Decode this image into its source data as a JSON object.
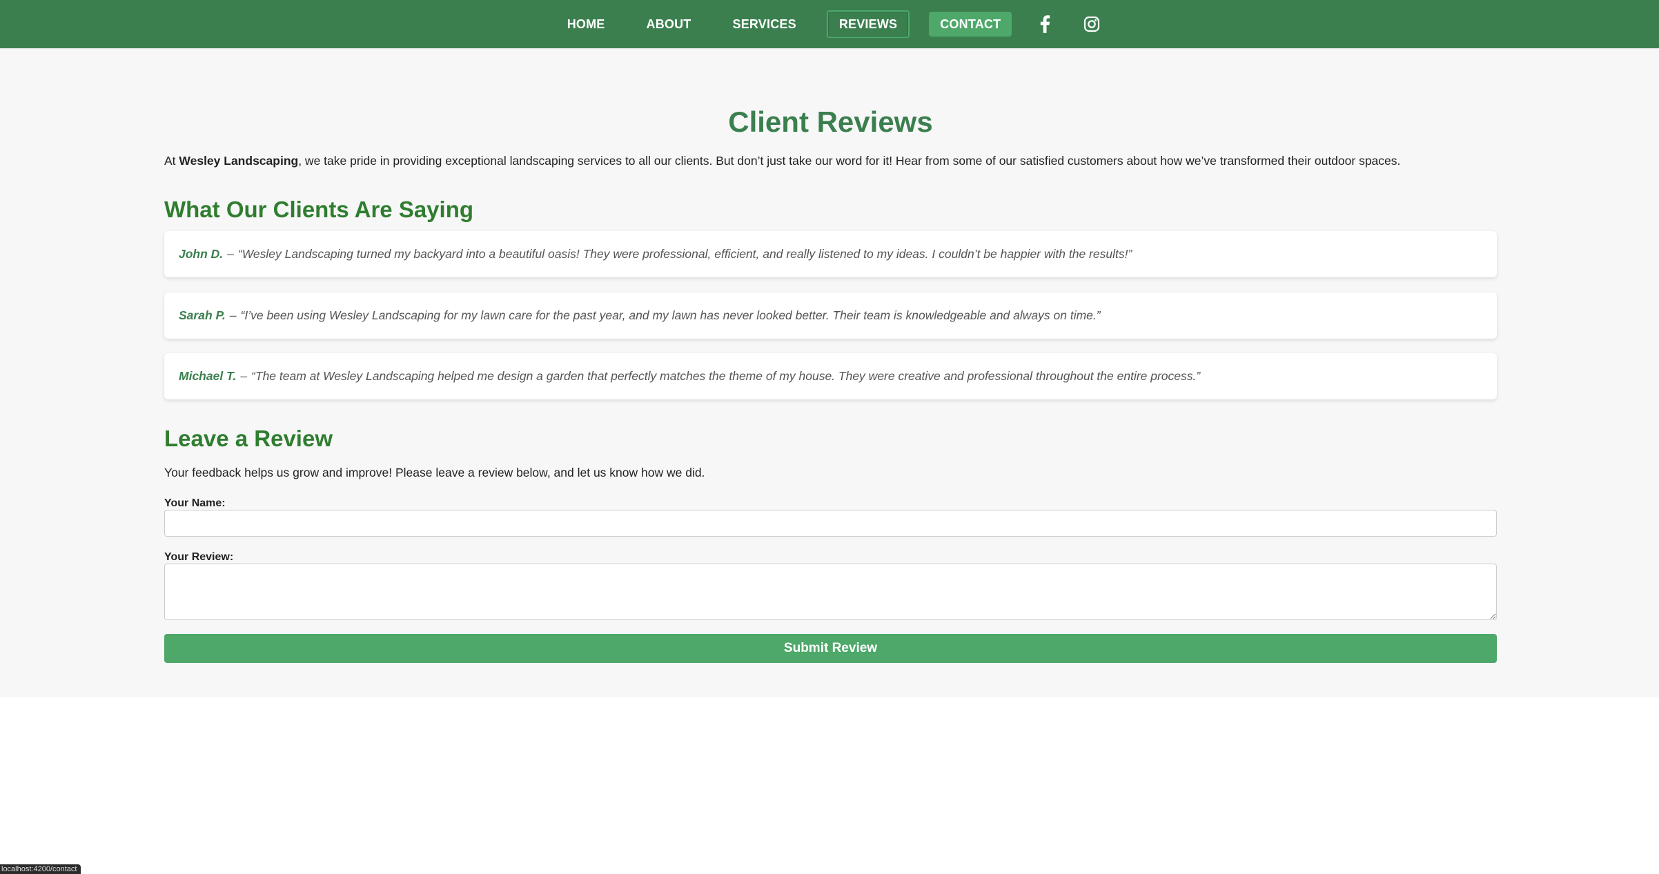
{
  "nav": {
    "links": [
      {
        "label": "HOME"
      },
      {
        "label": "ABOUT"
      },
      {
        "label": "SERVICES"
      },
      {
        "label": "REVIEWS",
        "active": true
      },
      {
        "label": "CONTACT"
      }
    ],
    "social": [
      "facebook-icon",
      "instagram-icon"
    ]
  },
  "page": {
    "title": "Client Reviews",
    "intro_prefix": "At ",
    "intro_brand": "Wesley Landscaping",
    "intro_rest": ", we take pride in providing exceptional landscaping services to all our clients. But don’t just take our word for it! Hear from some of our satisfied customers about how we’ve transformed their outdoor spaces."
  },
  "testimonials": {
    "heading": "What Our Clients Are Saying",
    "items": [
      {
        "name": "John D.",
        "quote": "“Wesley Landscaping turned my backyard into a beautiful oasis! They were professional, efficient, and really listened to my ideas. I couldn’t be happier with the results!”"
      },
      {
        "name": "Sarah P.",
        "quote": "“I’ve been using Wesley Landscaping for my lawn care for the past year, and my lawn has never looked better. Their team is knowledgeable and always on time.”"
      },
      {
        "name": "Michael T.",
        "quote": "“The team at Wesley Landscaping helped me design a garden that perfectly matches the theme of my house. They were creative and professional throughout the entire process.”"
      }
    ]
  },
  "review_form": {
    "heading": "Leave a Review",
    "description": "Your feedback helps us grow and improve! Please leave a review below, and let us know how we did.",
    "name_label": "Your Name:",
    "name_value": "",
    "review_label": "Your Review:",
    "review_value": "",
    "submit_label": "Submit Review"
  },
  "status_bar": {
    "url": "localhost:4200/contact"
  },
  "colors": {
    "nav_bg": "#3b7f4f",
    "accent": "#4ea86a",
    "heading_green": "#2f7d2f",
    "page_bg": "#f7f7f7"
  }
}
